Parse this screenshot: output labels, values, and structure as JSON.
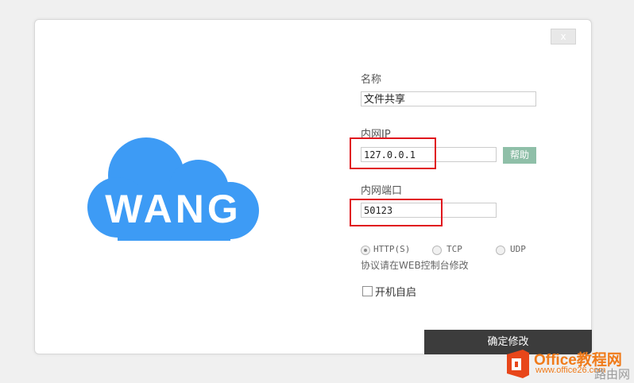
{
  "dialog": {
    "close_label": "x",
    "logo_text": "WANG",
    "name": {
      "label": "名称",
      "value": "文件共享"
    },
    "lan_ip": {
      "label": "内网IP",
      "value": "127.0.0.1",
      "help_label": "帮助"
    },
    "lan_port": {
      "label": "内网端口",
      "value": "50123"
    },
    "protocols": [
      {
        "label": "HTTP(S)",
        "checked": true
      },
      {
        "label": "TCP",
        "checked": false
      },
      {
        "label": "UDP",
        "checked": false
      }
    ],
    "protocol_hint": "协议请在WEB控制台修改",
    "autostart_label": "开机自启",
    "confirm_label": "确定修改"
  },
  "colors": {
    "logo_cloud": "#3d9bf5",
    "help_button": "#8fbfa8",
    "highlight": "#e0161d",
    "confirm_button": "#3c3c3c",
    "watermark": "#f07b1a"
  },
  "watermark": {
    "brand": "Office教程网",
    "url": "www.office26.com",
    "suffix": "路由网"
  }
}
